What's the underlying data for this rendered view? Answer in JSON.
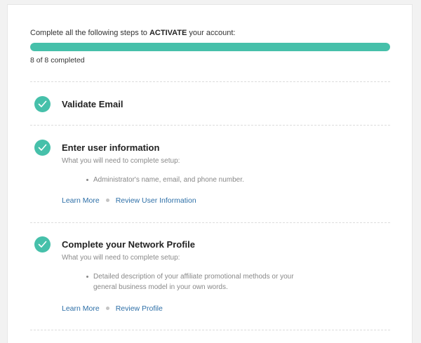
{
  "intro": {
    "prefix": "Complete all the following steps to ",
    "emphasis": "ACTIVATE",
    "suffix": " your account:"
  },
  "progress": {
    "completed": 8,
    "total": 8,
    "label": "8 of 8 completed",
    "color": "#46c0aa"
  },
  "steps": [
    {
      "title": "Validate Email",
      "icon": "check-circle-icon",
      "completed": true
    },
    {
      "title": "Enter user information",
      "icon": "check-circle-icon",
      "completed": true,
      "subtitle": "What you will need to complete setup:",
      "bullet": "Administrator's name, email, and phone number.",
      "learn_more": "Learn More",
      "action": "Review User Information"
    },
    {
      "title": "Complete your Network Profile",
      "icon": "check-circle-icon",
      "completed": true,
      "subtitle": "What you will need to complete setup:",
      "bullet": "Detailed description of your affiliate promotional methods or your general business model in your own words.",
      "learn_more": "Learn More",
      "action": "Review Profile"
    }
  ]
}
